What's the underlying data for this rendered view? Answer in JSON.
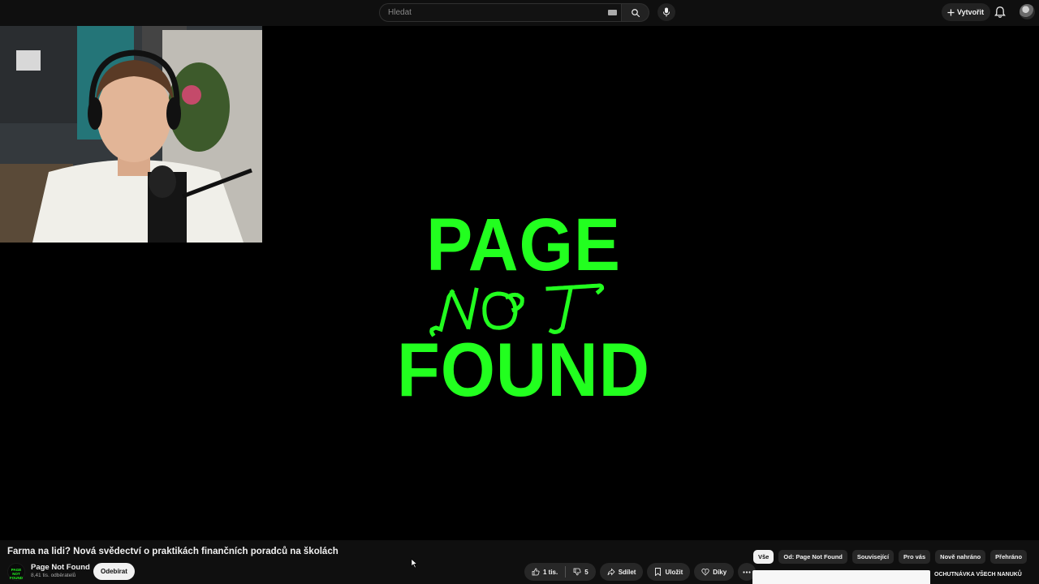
{
  "header": {
    "search_placeholder": "Hledat",
    "create_label": "Vytvořit"
  },
  "video": {
    "logo": {
      "line1": "PAGE",
      "line2": "NOT",
      "line3": "FOUND",
      "color": "#22ff1f"
    }
  },
  "info": {
    "title": "Farma na lidi? Nová svědectví o praktikách finančních poradců na školách",
    "channel": {
      "name": "Page Not Found",
      "subscribers": "8,41 tis. odběratelů",
      "avatar_text": "PAGE NOT FOUND"
    },
    "subscribe_label": "Odebírat",
    "actions": {
      "likes": "1 tis.",
      "dislikes": "5",
      "share": "Sdílet",
      "save": "Uložit",
      "thanks": "Díky"
    }
  },
  "sidebar": {
    "chips": [
      "Vše",
      "Od: Page Not Found",
      "Související",
      "Pro vás",
      "Nově nahráno",
      "Přehráno"
    ],
    "active_chip": "Vše",
    "recommendation_title": "OCHUTNÁVKA VŠECH NANUKŮ"
  }
}
